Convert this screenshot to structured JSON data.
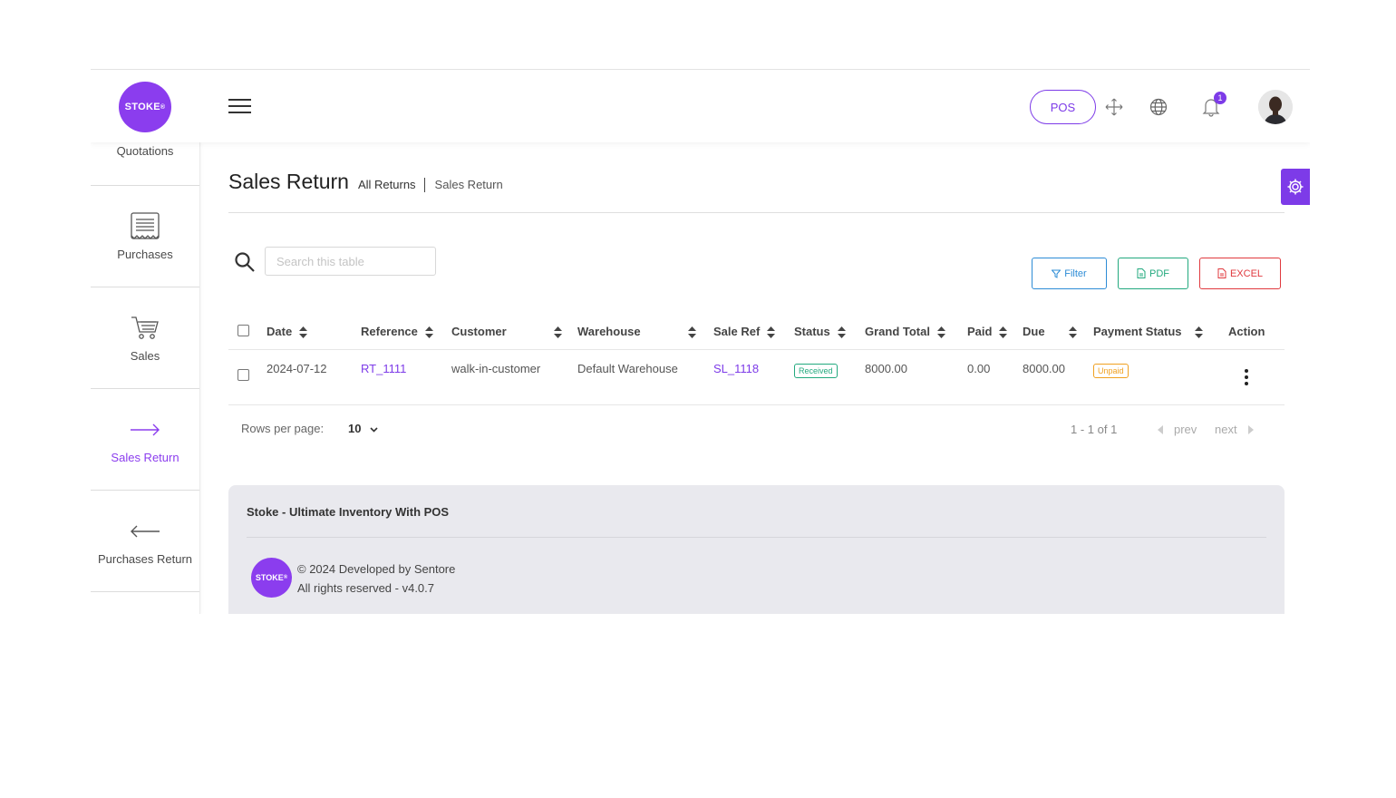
{
  "brand": {
    "logo_text": "STOKE",
    "accent": "#8b3dee"
  },
  "header": {
    "pos_label": "POS",
    "notification_count": "1",
    "icons": [
      "menu-icon",
      "fullscreen-icon",
      "globe-icon",
      "bell-icon",
      "avatar"
    ]
  },
  "sidebar": {
    "items": [
      {
        "label": "Quotations",
        "icon": "quotations-icon"
      },
      {
        "label": "Purchases",
        "icon": "receipt-icon"
      },
      {
        "label": "Sales",
        "icon": "cart-icon"
      },
      {
        "label": "Sales Return",
        "icon": "arrow-right-icon",
        "active": true
      },
      {
        "label": "Purchases Return",
        "icon": "arrow-left-icon"
      }
    ]
  },
  "page": {
    "title": "Sales Return",
    "breadcrumb": [
      "All Returns",
      "Sales Return"
    ]
  },
  "toolbar": {
    "search_placeholder": "Search this table",
    "filter_label": "Filter",
    "pdf_label": "PDF",
    "excel_label": "EXCEL"
  },
  "table": {
    "columns": [
      "Date",
      "Reference",
      "Customer",
      "Warehouse",
      "Sale Ref",
      "Status",
      "Grand Total",
      "Paid",
      "Due",
      "Payment Status",
      "Action"
    ],
    "rows": [
      {
        "date": "2024-07-12",
        "reference": "RT_1111",
        "customer": "walk-in-customer",
        "warehouse": "Default Warehouse",
        "sale_ref": "SL_1118",
        "status": "Received",
        "grand_total": "8000.00",
        "paid": "0.00",
        "due": "8000.00",
        "payment_status": "Unpaid"
      }
    ]
  },
  "pagination": {
    "rows_per_page_label": "Rows per page:",
    "rows_per_page": "10",
    "range": "1 - 1 of 1",
    "prev_label": "prev",
    "next_label": "next"
  },
  "footer": {
    "title": "Stoke - Ultimate Inventory With POS",
    "copyright": "© 2024 Developed by Sentore",
    "rights": "All rights reserved - v4.0.7"
  }
}
